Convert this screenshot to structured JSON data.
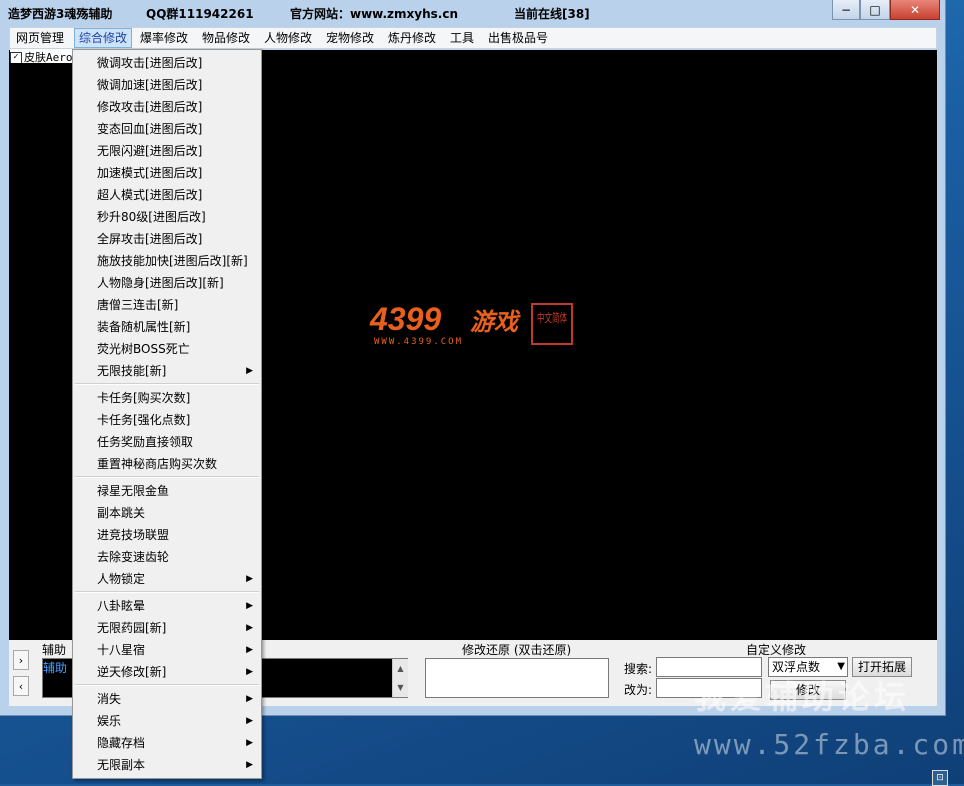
{
  "titlebar": {
    "app_name": "造梦西游3魂殇辅助",
    "qq_group": "QQ群111942261",
    "website": "官方网站：www.zmxyhs.cn",
    "online": "当前在线[38]"
  },
  "window_buttons": {
    "minimize": "−",
    "maximize": "□",
    "close": "✕"
  },
  "menu": {
    "items": [
      "网页管理",
      "综合修改",
      "爆率修改",
      "物品修改",
      "人物修改",
      "宠物修改",
      "炼丹修改",
      "工具",
      "出售极品号"
    ],
    "active_index": 1
  },
  "skin_checkbox": {
    "label": "皮肤Aero",
    "checked": true
  },
  "logo": {
    "brand_number": "4399",
    "brand_cn": "游戏",
    "url": "WWW.4399.COM",
    "seal": "中文简体"
  },
  "dropdown": {
    "groups": [
      {
        "items": [
          {
            "label": "微调攻击[进图后改]",
            "submenu": false
          },
          {
            "label": "微调加速[进图后改]",
            "submenu": false
          },
          {
            "label": "修改攻击[进图后改]",
            "submenu": false
          },
          {
            "label": "变态回血[进图后改]",
            "submenu": false
          },
          {
            "label": "无限闪避[进图后改]",
            "submenu": false
          },
          {
            "label": "加速模式[进图后改]",
            "submenu": false
          },
          {
            "label": "超人模式[进图后改]",
            "submenu": false
          },
          {
            "label": "秒升80级[进图后改]",
            "submenu": false
          },
          {
            "label": "全屏攻击[进图后改]",
            "submenu": false
          },
          {
            "label": "施放技能加快[进图后改][新]",
            "submenu": false
          },
          {
            "label": "人物隐身[进图后改][新]",
            "submenu": false
          },
          {
            "label": "唐僧三连击[新]",
            "submenu": false
          },
          {
            "label": "装备随机属性[新]",
            "submenu": false
          },
          {
            "label": "荧光树BOSS死亡",
            "submenu": false
          },
          {
            "label": "无限技能[新]",
            "submenu": true
          }
        ]
      },
      {
        "items": [
          {
            "label": "卡任务[购买次数]",
            "submenu": false
          },
          {
            "label": "卡任务[强化点数]",
            "submenu": false
          },
          {
            "label": "任务奖励直接领取",
            "submenu": false
          },
          {
            "label": "重置神秘商店购买次数",
            "submenu": false
          }
        ]
      },
      {
        "items": [
          {
            "label": "禄星无限金鱼",
            "submenu": false
          },
          {
            "label": "副本跳关",
            "submenu": false
          },
          {
            "label": "进竞技场联盟",
            "submenu": false
          },
          {
            "label": "去除变速齿轮",
            "submenu": false
          },
          {
            "label": "人物锁定",
            "submenu": true
          }
        ]
      },
      {
        "items": [
          {
            "label": "八卦眩晕",
            "submenu": true
          },
          {
            "label": "无限药园[新]",
            "submenu": true
          },
          {
            "label": "十八星宿",
            "submenu": true
          },
          {
            "label": "逆天修改[新]",
            "submenu": true
          }
        ]
      },
      {
        "items": [
          {
            "label": "消失",
            "submenu": true
          },
          {
            "label": "娱乐",
            "submenu": true
          },
          {
            "label": "隐藏存档",
            "submenu": true
          },
          {
            "label": "无限副本",
            "submenu": true
          }
        ]
      }
    ]
  },
  "bottom": {
    "nav_next": "›",
    "nav_prev": "‹",
    "aux_title": "辅助",
    "aux_text": "辅助",
    "restore_title": "修改还原 (双击还原)",
    "custom_title": "自定义修改",
    "search_label": "搜索:",
    "search_value": "",
    "change_label": "改为:",
    "change_value": "",
    "type_select": "双浮点数",
    "open_extend_button": "打开拓展",
    "modify_button": "修改"
  },
  "watermark": {
    "line1": "我爱辅助论坛",
    "line2": "www.52fzba.com"
  }
}
